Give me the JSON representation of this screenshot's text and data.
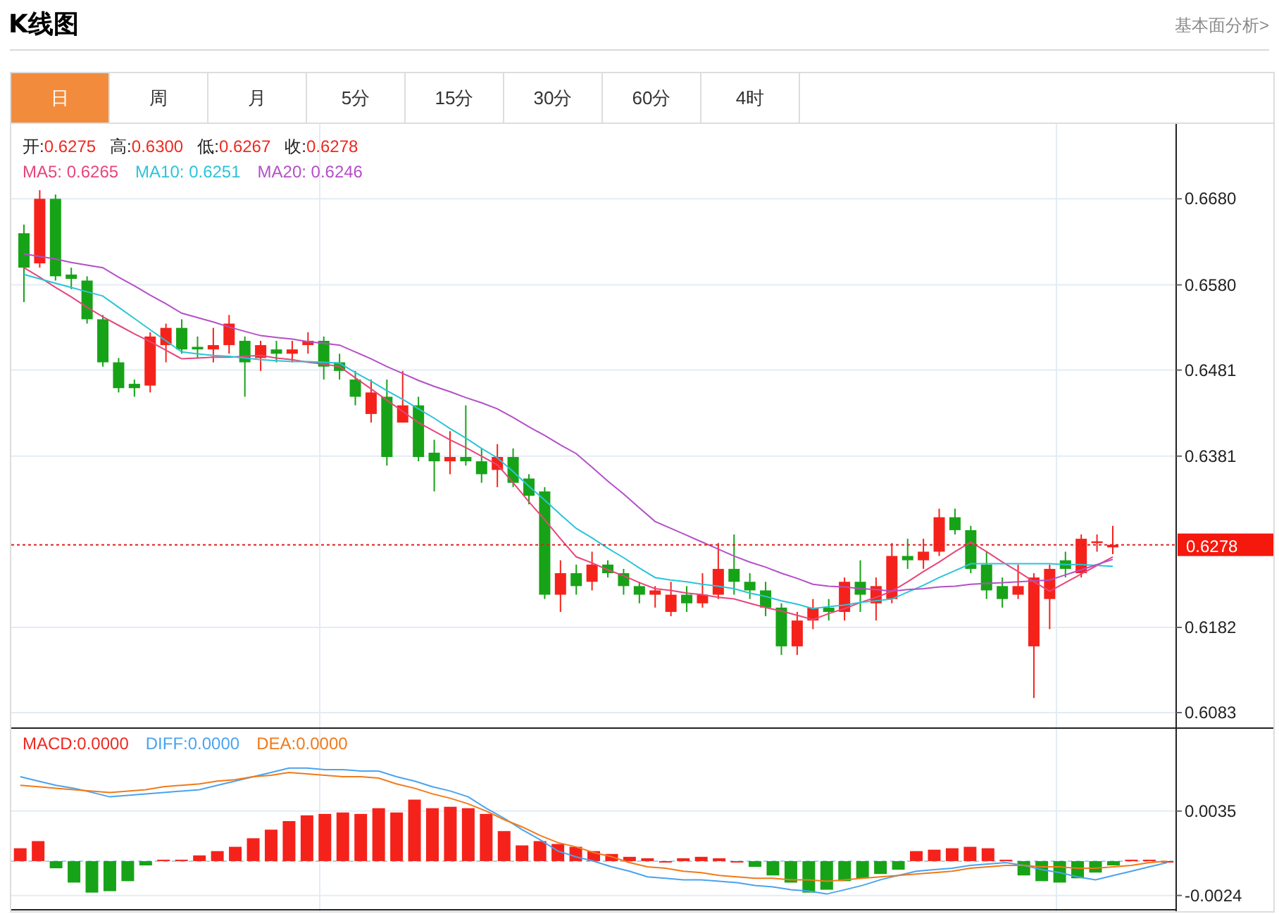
{
  "header": {
    "title": "K线图",
    "link": "基本面分析>"
  },
  "tabs": [
    {
      "label": "日",
      "selected": true
    },
    {
      "label": "周",
      "selected": false
    },
    {
      "label": "月",
      "selected": false
    },
    {
      "label": "5分",
      "selected": false
    },
    {
      "label": "15分",
      "selected": false
    },
    {
      "label": "30分",
      "selected": false
    },
    {
      "label": "60分",
      "selected": false
    },
    {
      "label": "4时",
      "selected": false
    }
  ],
  "price_legend": [
    {
      "label": "开:",
      "value": "0.6275"
    },
    {
      "label": "高:",
      "value": "0.6300"
    },
    {
      "label": "低:",
      "value": "0.6267"
    },
    {
      "label": "收:",
      "value": "0.6278"
    }
  ],
  "ma_legend": [
    "0.6265",
    "0.6251",
    "0.6246"
  ],
  "last_price": "0.6278",
  "price_chart": {
    "chart_data": {
      "type": "candlestick",
      "grid": true,
      "ylim": [
        0.6065,
        0.6767
      ],
      "relative": false,
      "yticks": [
        {
          "value": 0.668,
          "label": "0.6680"
        },
        {
          "value": 0.658,
          "label": "0.6580"
        },
        {
          "value": 0.6481,
          "label": "0.6481"
        },
        {
          "value": 0.6381,
          "label": "0.6381"
        },
        {
          "value": 0.6182,
          "label": "0.6182"
        },
        {
          "value": 0.6083,
          "label": "0.6083"
        }
      ],
      "categories": [
        null,
        null,
        null,
        null,
        null,
        null,
        null,
        null,
        null,
        null,
        null,
        null,
        null,
        null,
        null,
        null,
        null,
        null,
        null,
        null,
        null,
        null,
        null,
        null,
        null,
        null,
        null,
        null,
        null,
        null,
        null,
        null,
        null,
        null,
        null,
        null,
        null,
        null,
        null,
        null,
        null,
        null,
        null,
        null,
        null,
        null,
        null,
        null,
        null,
        null,
        null,
        null,
        null,
        null,
        null,
        null,
        null,
        null,
        null,
        null,
        null,
        null,
        null,
        null,
        null,
        null,
        null,
        null,
        null,
        null
      ],
      "series": [
        {
          "name": "MA5:",
          "type": "line",
          "color": "#e8457a",
          "values": [
            0.66,
            0.6589,
            0.6577,
            0.6566,
            0.6554,
            0.6543,
            0.6533,
            0.6523,
            0.6514,
            0.6504,
            0.6494,
            0.6495,
            0.6496,
            0.6496,
            0.6497,
            0.6498,
            0.6495,
            0.6493,
            0.649,
            0.6488,
            0.6485,
            0.6472,
            0.6459,
            0.6446,
            0.6433,
            0.642,
            0.641,
            0.64,
            0.6391,
            0.6381,
            0.6371,
            0.635,
            0.6328,
            0.6307,
            0.6285,
            0.6264,
            0.6257,
            0.6249,
            0.6242,
            0.6234,
            0.6227,
            0.6225,
            0.6222,
            0.622,
            0.6217,
            0.6215,
            0.621,
            0.6205,
            0.6201,
            0.6196,
            0.6191,
            0.6198,
            0.6204,
            0.6211,
            0.6217,
            0.6224,
            0.6235,
            0.6247,
            0.6258,
            0.627,
            0.6281,
            0.627,
            0.6258,
            0.6247,
            0.6235,
            0.6224,
            0.6234,
            0.6244,
            0.6254,
            0.6264
          ]
        },
        {
          "name": "MA10:",
          "type": "line",
          "color": "#2bc4d8",
          "values": [
            0.6592,
            0.6587,
            0.6582,
            0.6577,
            0.6572,
            0.6567,
            0.6554,
            0.6541,
            0.6528,
            0.6515,
            0.6502,
            0.65,
            0.6498,
            0.6497,
            0.6495,
            0.6493,
            0.6492,
            0.6491,
            0.6491,
            0.649,
            0.6489,
            0.6478,
            0.6468,
            0.6457,
            0.6447,
            0.6436,
            0.6425,
            0.6413,
            0.6402,
            0.639,
            0.6379,
            0.6363,
            0.6346,
            0.633,
            0.6313,
            0.6297,
            0.6286,
            0.6274,
            0.6263,
            0.6251,
            0.624,
            0.6237,
            0.6235,
            0.6232,
            0.623,
            0.6227,
            0.6222,
            0.6218,
            0.6213,
            0.6209,
            0.6204,
            0.6206,
            0.6208,
            0.6211,
            0.6213,
            0.6215,
            0.6223,
            0.6231,
            0.624,
            0.6248,
            0.6256,
            0.6256,
            0.6256,
            0.6256,
            0.6256,
            0.6256,
            0.6255,
            0.6255,
            0.6254,
            0.6253
          ]
        },
        {
          "name": "MA20:",
          "type": "line",
          "color": "#b44fc8",
          "values": [
            0.6616,
            0.6613,
            0.661,
            0.6606,
            0.6603,
            0.66,
            0.6589,
            0.6579,
            0.6568,
            0.6558,
            0.6547,
            0.6542,
            0.6537,
            0.6531,
            0.6526,
            0.6521,
            0.6519,
            0.6517,
            0.6514,
            0.6512,
            0.651,
            0.6502,
            0.6494,
            0.6485,
            0.6477,
            0.6469,
            0.6462,
            0.6456,
            0.6449,
            0.6443,
            0.6436,
            0.6426,
            0.6415,
            0.6405,
            0.6394,
            0.6384,
            0.6368,
            0.6352,
            0.6337,
            0.6321,
            0.6305,
            0.6297,
            0.6289,
            0.6281,
            0.6273,
            0.6265,
            0.6258,
            0.6252,
            0.6245,
            0.6239,
            0.6232,
            0.623,
            0.6229,
            0.6227,
            0.6226,
            0.6224,
            0.6226,
            0.6227,
            0.6229,
            0.623,
            0.6232,
            0.6233,
            0.6234,
            0.6235,
            0.6236,
            0.6237,
            0.6243,
            0.6249,
            0.6255,
            0.6261
          ]
        }
      ],
      "ref_lines": [
        {
          "axis": "y",
          "value": 0.6278
        }
      ],
      "ohlc": [
        [
          0.664,
          0.665,
          0.656,
          0.66
        ],
        [
          0.6605,
          0.669,
          0.66,
          0.668
        ],
        [
          0.668,
          0.6685,
          0.6585,
          0.659
        ],
        [
          0.6592,
          0.66,
          0.6575,
          0.6587
        ],
        [
          0.6585,
          0.659,
          0.6535,
          0.654
        ],
        [
          0.654,
          0.6545,
          0.6485,
          0.649
        ],
        [
          0.649,
          0.6495,
          0.6455,
          0.646
        ],
        [
          0.6465,
          0.647,
          0.645,
          0.646
        ],
        [
          0.6463,
          0.6525,
          0.6455,
          0.652
        ],
        [
          0.651,
          0.6535,
          0.649,
          0.653
        ],
        [
          0.653,
          0.654,
          0.65,
          0.6505
        ],
        [
          0.6508,
          0.652,
          0.6495,
          0.6505
        ],
        [
          0.6505,
          0.653,
          0.649,
          0.651
        ],
        [
          0.651,
          0.6545,
          0.65,
          0.6535
        ],
        [
          0.6515,
          0.652,
          0.645,
          0.649
        ],
        [
          0.6495,
          0.6515,
          0.648,
          0.651
        ],
        [
          0.6505,
          0.6515,
          0.649,
          0.65
        ],
        [
          0.65,
          0.6515,
          0.649,
          0.6505
        ],
        [
          0.651,
          0.6525,
          0.65,
          0.6515
        ],
        [
          0.6515,
          0.652,
          0.647,
          0.6485
        ],
        [
          0.649,
          0.65,
          0.647,
          0.648
        ],
        [
          0.647,
          0.648,
          0.644,
          0.645
        ],
        [
          0.643,
          0.647,
          0.642,
          0.6455
        ],
        [
          0.645,
          0.647,
          0.637,
          0.638
        ],
        [
          0.642,
          0.648,
          0.642,
          0.644
        ],
        [
          0.644,
          0.645,
          0.6375,
          0.638
        ],
        [
          0.6385,
          0.64,
          0.634,
          0.6375
        ],
        [
          0.6375,
          0.641,
          0.636,
          0.638
        ],
        [
          0.638,
          0.644,
          0.637,
          0.6375
        ],
        [
          0.6375,
          0.639,
          0.635,
          0.636
        ],
        [
          0.6365,
          0.6395,
          0.6345,
          0.638
        ],
        [
          0.638,
          0.639,
          0.6345,
          0.635
        ],
        [
          0.6355,
          0.636,
          0.6325,
          0.6335
        ],
        [
          0.634,
          0.6345,
          0.6215,
          0.622
        ],
        [
          0.622,
          0.626,
          0.62,
          0.6245
        ],
        [
          0.6245,
          0.6255,
          0.622,
          0.623
        ],
        [
          0.6235,
          0.627,
          0.6225,
          0.6255
        ],
        [
          0.6255,
          0.626,
          0.624,
          0.6245
        ],
        [
          0.6245,
          0.625,
          0.622,
          0.623
        ],
        [
          0.623,
          0.6235,
          0.621,
          0.622
        ],
        [
          0.622,
          0.623,
          0.6205,
          0.6225
        ],
        [
          0.62,
          0.6235,
          0.6195,
          0.622
        ],
        [
          0.622,
          0.623,
          0.62,
          0.621
        ],
        [
          0.621,
          0.6245,
          0.6205,
          0.622
        ],
        [
          0.622,
          0.628,
          0.6215,
          0.625
        ],
        [
          0.625,
          0.629,
          0.622,
          0.6235
        ],
        [
          0.6235,
          0.6245,
          0.6215,
          0.6225
        ],
        [
          0.6225,
          0.6235,
          0.6195,
          0.6205
        ],
        [
          0.6205,
          0.621,
          0.615,
          0.616
        ],
        [
          0.616,
          0.62,
          0.615,
          0.619
        ],
        [
          0.619,
          0.6215,
          0.618,
          0.6205
        ],
        [
          0.6205,
          0.6215,
          0.619,
          0.62
        ],
        [
          0.62,
          0.624,
          0.619,
          0.6235
        ],
        [
          0.6235,
          0.626,
          0.62,
          0.622
        ],
        [
          0.621,
          0.624,
          0.619,
          0.623
        ],
        [
          0.6215,
          0.628,
          0.621,
          0.6265
        ],
        [
          0.6265,
          0.6285,
          0.625,
          0.626
        ],
        [
          0.626,
          0.6285,
          0.625,
          0.627
        ],
        [
          0.627,
          0.632,
          0.6265,
          0.631
        ],
        [
          0.631,
          0.632,
          0.629,
          0.6295
        ],
        [
          0.6295,
          0.63,
          0.6245,
          0.625
        ],
        [
          0.6255,
          0.627,
          0.6215,
          0.6225
        ],
        [
          0.623,
          0.624,
          0.6205,
          0.6215
        ],
        [
          0.622,
          0.6255,
          0.6215,
          0.623
        ],
        [
          0.616,
          0.6245,
          0.61,
          0.624
        ],
        [
          0.6215,
          0.6255,
          0.618,
          0.625
        ],
        [
          0.626,
          0.627,
          0.624,
          0.625
        ],
        [
          0.6245,
          0.629,
          0.624,
          0.6285
        ],
        [
          0.628,
          0.629,
          0.627,
          0.6282
        ],
        [
          0.6275,
          0.63,
          0.6267,
          0.6278
        ]
      ]
    }
  },
  "macd_legend": [
    "0.0000",
    "0.0000",
    "0.0000"
  ],
  "macd_chart": {
    "chart_data": {
      "type": "bar",
      "ylim": [
        -0.0035,
        0.0093
      ],
      "yticks": [
        {
          "value": 0.0035,
          "label": "0.0035"
        },
        {
          "value": -0.0024,
          "label": "-0.0024"
        }
      ],
      "ref_lines": [
        {
          "axis": "y",
          "value": 0
        }
      ],
      "categories": [
        null,
        null,
        null,
        null,
        null,
        null,
        null,
        null,
        null,
        null,
        null,
        null,
        null,
        null,
        null,
        null,
        null,
        null,
        null,
        null,
        null,
        null,
        null,
        null,
        null,
        null,
        null,
        null,
        null,
        null,
        null,
        null,
        null,
        null,
        null,
        null,
        null,
        null,
        null,
        null,
        null,
        null,
        null,
        null,
        null,
        null,
        null,
        null,
        null,
        null,
        null,
        null,
        null,
        null,
        null,
        null,
        null,
        null,
        null,
        null,
        null,
        null,
        null,
        null,
        null
      ],
      "series": [
        {
          "name": "MACD:",
          "colors": [
            "#f5221b",
            "#f5221b",
            "#17a317",
            "#17a317",
            "#17a317",
            "#17a317",
            "#17a317",
            "#17a317",
            "#f5221b",
            "#f5221b",
            "#f5221b",
            "#f5221b",
            "#f5221b",
            "#f5221b",
            "#f5221b",
            "#f5221b",
            "#f5221b",
            "#f5221b",
            "#f5221b",
            "#f5221b",
            "#f5221b",
            "#f5221b",
            "#f5221b",
            "#f5221b",
            "#f5221b",
            "#f5221b",
            "#f5221b",
            "#f5221b",
            "#f5221b",
            "#f5221b",
            "#f5221b",
            "#f5221b",
            "#f5221b",
            "#f5221b",
            "#f5221b",
            "#f5221b",
            "#f5221b",
            "#f5221b",
            "#f5221b",
            "#f5221b",
            "#f5221b",
            "#17a317",
            "#17a317",
            "#17a317",
            "#17a317",
            "#17a317",
            "#17a317",
            "#17a317",
            "#17a317",
            "#17a317",
            "#f5221b",
            "#f5221b",
            "#f5221b",
            "#f5221b",
            "#f5221b",
            "#f5221b",
            "#17a317",
            "#17a317",
            "#17a317",
            "#17a317",
            "#17a317",
            "#17a317",
            "#f5221b",
            "#f5221b",
            "#f5221b"
          ],
          "values": [
            0.0009,
            0.0014,
            -0.0005,
            -0.0015,
            -0.0022,
            -0.0021,
            -0.0014,
            -0.0003,
            0.0001,
            0.0001,
            0.0004,
            0.0007,
            0.001,
            0.0016,
            0.0022,
            0.0028,
            0.0032,
            0.0033,
            0.0034,
            0.0033,
            0.0037,
            0.0034,
            0.0043,
            0.0037,
            0.0038,
            0.0037,
            0.0033,
            0.0021,
            0.0011,
            0.0014,
            0.0012,
            0.001,
            0.0007,
            0.0005,
            0.0003,
            0.0002,
            0.0,
            0.0002,
            0.0003,
            0.0002,
            0.0,
            -0.0004,
            -0.001,
            -0.0015,
            -0.0022,
            -0.002,
            -0.0014,
            -0.0012,
            -0.0009,
            -0.0006,
            0.0007,
            0.0008,
            0.0009,
            0.001,
            0.0009,
            0.0001,
            -0.001,
            -0.0014,
            -0.0015,
            -0.0012,
            -0.0008,
            -0.0003,
            0.0001,
            0.0001,
            0.0
          ]
        },
        {
          "name": "DIFF:",
          "type": "line",
          "color": "#4aa3f0",
          "values": [
            0.0059,
            0.0056,
            0.0053,
            0.0051,
            0.0048,
            0.0045,
            0.0046,
            0.0047,
            0.0048,
            0.0049,
            0.005,
            0.0053,
            0.0056,
            0.0059,
            0.0062,
            0.0065,
            0.0065,
            0.0064,
            0.0064,
            0.0063,
            0.0063,
            0.0059,
            0.0056,
            0.0052,
            0.0049,
            0.0045,
            0.0037,
            0.003,
            0.0022,
            0.0015,
            0.0007,
            0.0003,
            0.0,
            -0.0004,
            -0.0007,
            -0.0011,
            -0.0012,
            -0.0013,
            -0.0013,
            -0.0014,
            -0.0015,
            -0.0017,
            -0.0018,
            -0.002,
            -0.0021,
            -0.0023,
            -0.002,
            -0.0017,
            -0.0013,
            -0.001,
            -0.0007,
            -0.0006,
            -0.0005,
            -0.0003,
            -0.0002,
            -0.0001,
            -0.0003,
            -0.0006,
            -0.0008,
            -0.0011,
            -0.0013,
            -0.001,
            -0.0007,
            -0.0004,
            -0.0001
          ]
        },
        {
          "name": "DEA:",
          "type": "line",
          "color": "#f07a1a",
          "values": [
            0.0053,
            0.0052,
            0.0051,
            0.005,
            0.0049,
            0.0048,
            0.0049,
            0.005,
            0.0052,
            0.0053,
            0.0054,
            0.0056,
            0.0057,
            0.0059,
            0.006,
            0.0062,
            0.0061,
            0.006,
            0.0059,
            0.0059,
            0.0058,
            0.0054,
            0.0051,
            0.0047,
            0.0044,
            0.004,
            0.0035,
            0.0029,
            0.0024,
            0.0018,
            0.0013,
            0.001,
            0.0006,
            0.0003,
            -0.0001,
            -0.0004,
            -0.0005,
            -0.0007,
            -0.0008,
            -0.001,
            -0.0011,
            -0.0012,
            -0.0012,
            -0.0013,
            -0.0013,
            -0.0014,
            -0.0013,
            -0.0012,
            -0.0011,
            -0.001,
            -0.0009,
            -0.0008,
            -0.0007,
            -0.0005,
            -0.0004,
            -0.0003,
            -0.0003,
            -0.0004,
            -0.0004,
            -0.0005,
            -0.0005,
            -0.0004,
            -0.0003,
            -0.0001,
            0.0
          ]
        }
      ]
    }
  }
}
